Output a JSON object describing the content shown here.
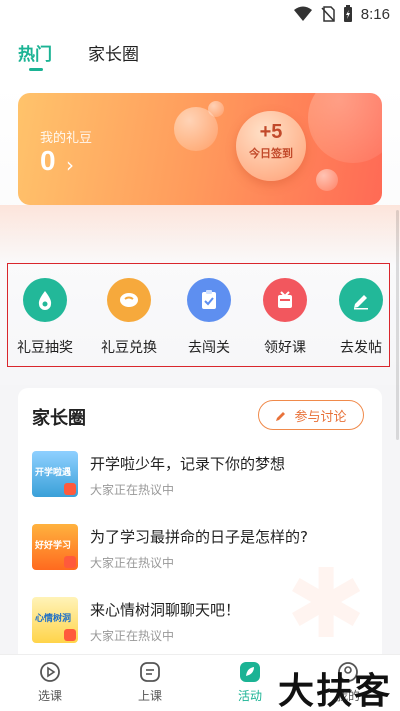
{
  "status_bar": {
    "time": "8:16",
    "icons": [
      "wifi-icon",
      "no-sim-icon",
      "battery-charging-icon"
    ]
  },
  "top_tabs": [
    {
      "label": "热门",
      "active": true
    },
    {
      "label": "家长圈",
      "active": false
    }
  ],
  "beans_card": {
    "title": "我的礼豆",
    "count": "0",
    "arrow": "›",
    "checkin_points": "+5",
    "checkin_label": "今日签到"
  },
  "actions": [
    {
      "label": "礼豆抽奖",
      "icon": "bean-drop-icon",
      "color": "#22b899"
    },
    {
      "label": "礼豆兑换",
      "icon": "bean-icon",
      "color": "#f6a93c"
    },
    {
      "label": "去闯关",
      "icon": "clipboard-check-icon",
      "color": "#5e8ff0"
    },
    {
      "label": "领好课",
      "icon": "gift-box-icon",
      "color": "#f2575e"
    },
    {
      "label": "去发帖",
      "icon": "edit-icon",
      "color": "#22b899"
    }
  ],
  "parent_circle": {
    "title": "家长圈",
    "join_label": "参与讨论",
    "topics": [
      {
        "title": "开学啦少年，记录下你的梦想",
        "subtitle": "大家正在热议中",
        "thumb_text": "开学啦遇",
        "thumb_color": "#3aa0d8"
      },
      {
        "title": "为了学习最拼命的日子是怎样的?",
        "subtitle": "大家正在热议中",
        "thumb_text": "好好学习",
        "thumb_color": "#ff7a2e"
      },
      {
        "title": "来心情树洞聊聊天吧！",
        "subtitle": "大家正在热议中",
        "thumb_text": "心情树洞",
        "thumb_color": "#ffd44a"
      }
    ]
  },
  "bottom_nav": [
    {
      "label": "选课",
      "icon": "play-circle-icon",
      "active": false
    },
    {
      "label": "上课",
      "icon": "class-icon",
      "active": false
    },
    {
      "label": "活动",
      "icon": "leaf-icon",
      "active": true
    },
    {
      "label": "我的",
      "icon": "profile-icon",
      "active": false
    }
  ],
  "watermark": "大扶客",
  "colors": {
    "accent": "#1bb394",
    "orange": "#e8723a",
    "highlight_box": "#d9262c"
  }
}
